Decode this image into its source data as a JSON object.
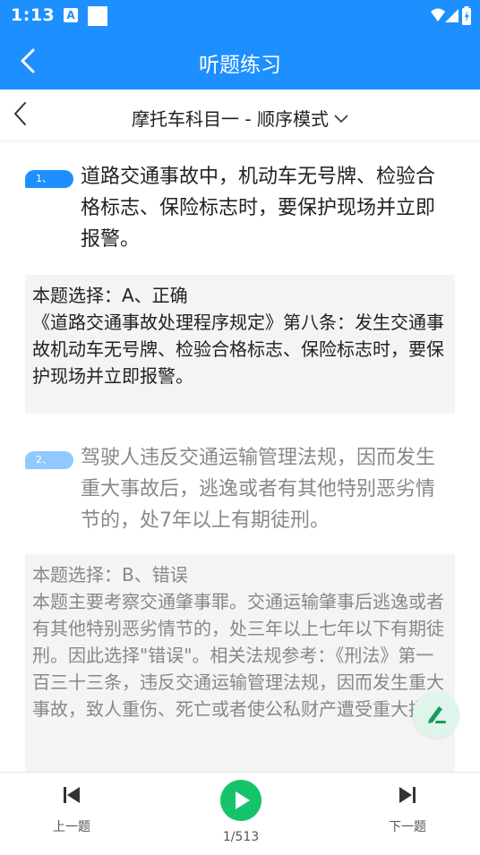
{
  "status_bar": {
    "time": "1:13",
    "notification_badge": "A"
  },
  "app_bar": {
    "title": "听题练习"
  },
  "sub_header": {
    "title": "摩托车科目一 - 顺序模式"
  },
  "questions": [
    {
      "number": "1、",
      "text": "道路交通事故中，机动车无号牌、检验合格标志、保险标志时，要保护现场并立即报警。",
      "answer_lines": [
        "本题选择：A、正确",
        "《道路交通事故处理程序规定》第八条：发生交通事故机动车无号牌、检验合格标志、保险标志时，要保护现场并立即报警。"
      ],
      "badge_color": "#1e8fff"
    },
    {
      "number": "2、",
      "text": "驾驶人违反交通运输管理法规，因而发生重大事故后，逃逸或者有其他特别恶劣情节的，处7年以上有期徒刑。",
      "answer_lines": [
        "本题选择：B、错误",
        "本题主要考察交通肇事罪。交通运输肇事后逃逸或者有其他特别恶劣情节的，处三年以上七年以下有期徒刑。因此选择\"错误\"。相关法规参考：《刑法》第一百三十三条，违反交通运输管理法规，因而发生重大事故，致人重伤、死亡或者使公私财产遭受重大损"
      ],
      "badge_color": "#8fc9ff"
    }
  ],
  "bottom_bar": {
    "prev_label": "上一题",
    "progress": "1/513",
    "next_label": "下一题",
    "play_color": "#15c46a"
  },
  "colors": {
    "primary": "#1e8fff",
    "answer_bg": "#f4f4f4",
    "fab_bg": "#dff4ea",
    "fab_icon": "#1a9c5f"
  }
}
